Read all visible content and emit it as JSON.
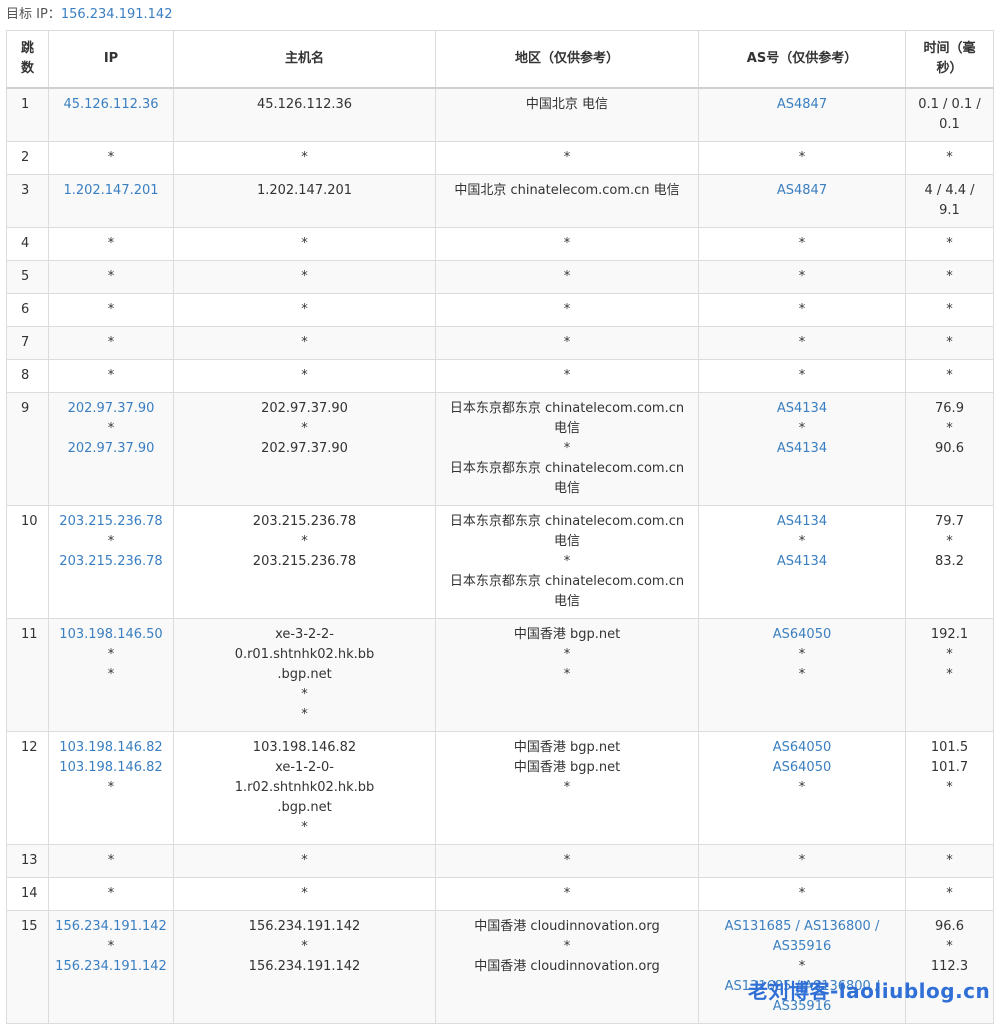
{
  "target": {
    "label": "目标 IP：",
    "ip": "156.234.191.142"
  },
  "headers": [
    "跳数",
    "IP",
    "主机名",
    "地区（仅供参考）",
    "AS号（仅供参考）",
    "时间（毫秒）"
  ],
  "rows": [
    {
      "hop": "1",
      "ip": [
        "45.126.112.36"
      ],
      "host": [
        "45.126.112.36"
      ],
      "region": [
        "中国北京 电信"
      ],
      "as": [
        "AS4847"
      ],
      "time": [
        "0.1 / 0.1 / 0.1"
      ]
    },
    {
      "hop": "2",
      "ip": [
        "*"
      ],
      "host": [
        "*"
      ],
      "region": [
        "*"
      ],
      "as": [
        "*"
      ],
      "time": [
        "*"
      ]
    },
    {
      "hop": "3",
      "ip": [
        "1.202.147.201"
      ],
      "host": [
        "1.202.147.201"
      ],
      "region": [
        "中国北京 chinatelecom.com.cn 电信"
      ],
      "as": [
        "AS4847"
      ],
      "time": [
        "4 / 4.4 / 9.1"
      ]
    },
    {
      "hop": "4",
      "ip": [
        "*"
      ],
      "host": [
        "*"
      ],
      "region": [
        "*"
      ],
      "as": [
        "*"
      ],
      "time": [
        "*"
      ]
    },
    {
      "hop": "5",
      "ip": [
        "*"
      ],
      "host": [
        "*"
      ],
      "region": [
        "*"
      ],
      "as": [
        "*"
      ],
      "time": [
        "*"
      ]
    },
    {
      "hop": "6",
      "ip": [
        "*"
      ],
      "host": [
        "*"
      ],
      "region": [
        "*"
      ],
      "as": [
        "*"
      ],
      "time": [
        "*"
      ]
    },
    {
      "hop": "7",
      "ip": [
        "*"
      ],
      "host": [
        "*"
      ],
      "region": [
        "*"
      ],
      "as": [
        "*"
      ],
      "time": [
        "*"
      ]
    },
    {
      "hop": "8",
      "ip": [
        "*"
      ],
      "host": [
        "*"
      ],
      "region": [
        "*"
      ],
      "as": [
        "*"
      ],
      "time": [
        "*"
      ]
    },
    {
      "hop": "9",
      "ip": [
        "202.97.37.90",
        "*",
        "202.97.37.90"
      ],
      "host": [
        "202.97.37.90",
        "*",
        "202.97.37.90"
      ],
      "region": [
        "日本东京都东京 chinatelecom.com.cn 电信",
        "*",
        "日本东京都东京 chinatelecom.com.cn 电信"
      ],
      "as": [
        "AS4134",
        "*",
        "AS4134"
      ],
      "time": [
        "76.9",
        "*",
        "90.6"
      ]
    },
    {
      "hop": "10",
      "ip": [
        "203.215.236.78",
        "*",
        "203.215.236.78"
      ],
      "host": [
        "203.215.236.78",
        "*",
        "203.215.236.78"
      ],
      "region": [
        "日本东京都东京 chinatelecom.com.cn 电信",
        "*",
        "日本东京都东京 chinatelecom.com.cn 电信"
      ],
      "as": [
        "AS4134",
        "*",
        "AS4134"
      ],
      "time": [
        "79.7",
        "*",
        "83.2"
      ]
    },
    {
      "hop": "11",
      "ip": [
        "103.198.146.50",
        "*",
        "*"
      ],
      "host": [
        "xe-3-2-2-0.r01.shtnhk02.hk.bb.bgp.net",
        "*",
        "*"
      ],
      "region": [
        "中国香港 bgp.net",
        "*",
        "*"
      ],
      "as": [
        "AS64050",
        "*",
        "*"
      ],
      "time": [
        "192.1",
        "*",
        "*"
      ]
    },
    {
      "hop": "12",
      "ip": [
        "103.198.146.82",
        "103.198.146.82",
        "*"
      ],
      "host": [
        "103.198.146.82",
        "xe-1-2-0-1.r02.shtnhk02.hk.bb.bgp.net",
        "*"
      ],
      "region": [
        "中国香港 bgp.net",
        "中国香港 bgp.net",
        "*"
      ],
      "as": [
        "AS64050",
        "AS64050",
        "*"
      ],
      "time": [
        "101.5",
        "101.7",
        "*"
      ]
    },
    {
      "hop": "13",
      "ip": [
        "*"
      ],
      "host": [
        "*"
      ],
      "region": [
        "*"
      ],
      "as": [
        "*"
      ],
      "time": [
        "*"
      ]
    },
    {
      "hop": "14",
      "ip": [
        "*"
      ],
      "host": [
        "*"
      ],
      "region": [
        "*"
      ],
      "as": [
        "*"
      ],
      "time": [
        "*"
      ]
    },
    {
      "hop": "15",
      "ip": [
        "156.234.191.142",
        "*",
        "156.234.191.142"
      ],
      "host": [
        "156.234.191.142",
        "*",
        "156.234.191.142"
      ],
      "region": [
        "中国香港 cloudinnovation.org",
        "*",
        "中国香港 cloudinnovation.org"
      ],
      "as": [
        "AS131685 / AS136800 / AS35916",
        "*",
        "AS131685 / AS136800 / AS35916"
      ],
      "time": [
        "96.6",
        "*",
        "112.3"
      ]
    }
  ],
  "watermark": "老刘博客-laoliublog.cn",
  "colors": {
    "link": "#3a7fc1",
    "stripe": "#f9f9f9",
    "border": "#dcdcdc"
  }
}
